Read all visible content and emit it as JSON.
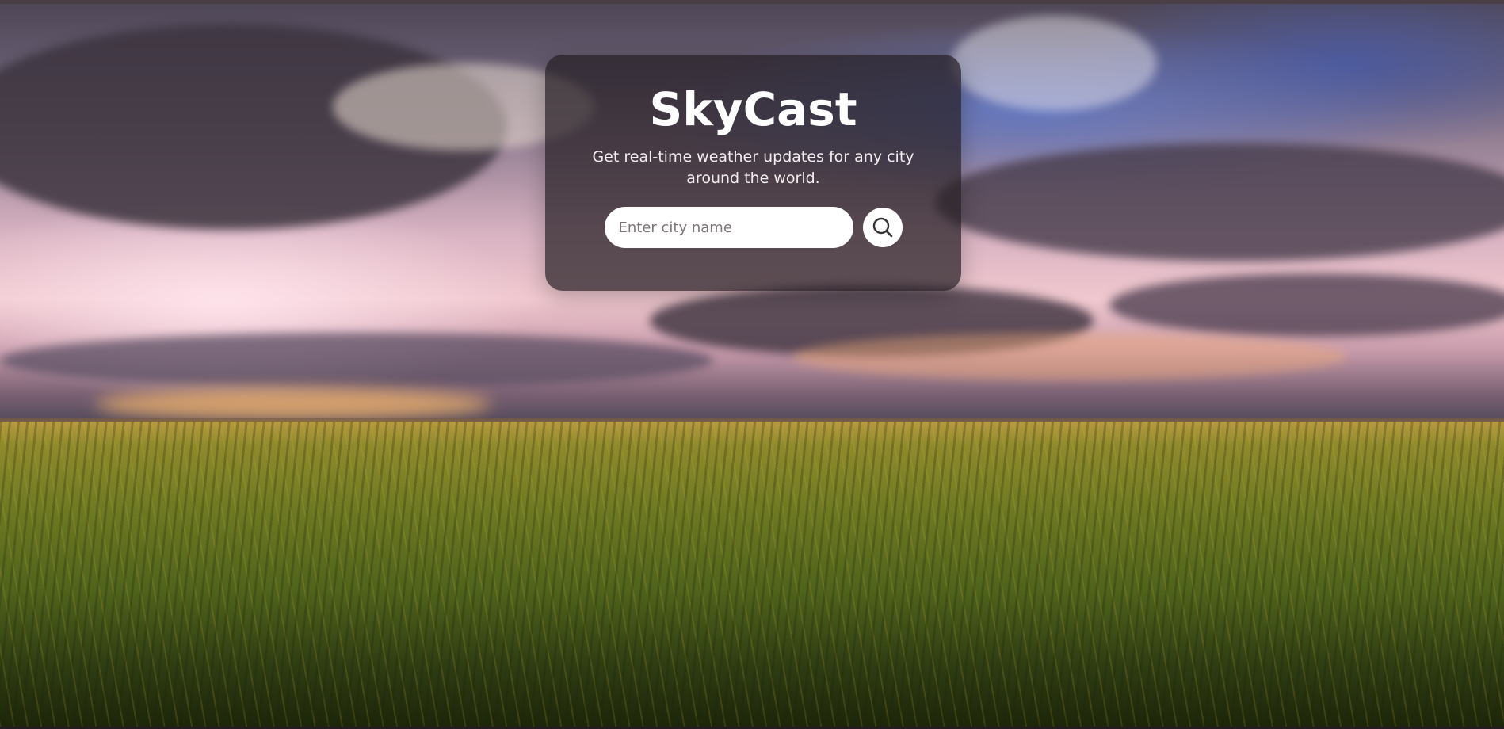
{
  "app": {
    "title": "SkyCast",
    "subtitle": "Get real-time weather updates for any city around the world."
  },
  "search": {
    "placeholder": "Enter city name",
    "value": "",
    "button_icon": "search-icon"
  },
  "colors": {
    "card_background": "#261e24",
    "text": "#ffffff",
    "input_background": "#ffffff"
  }
}
